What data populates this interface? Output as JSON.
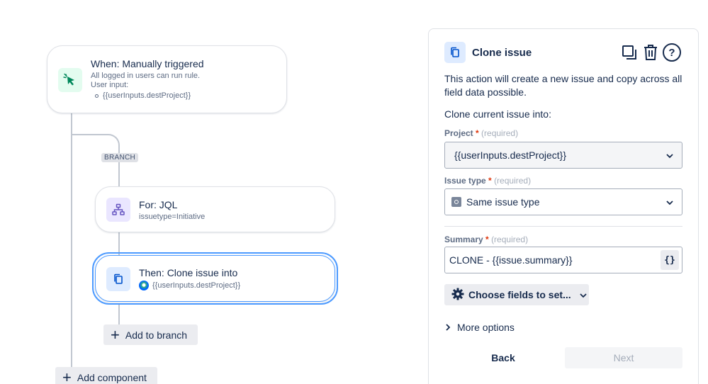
{
  "canvas": {
    "trigger": {
      "title": "When: Manually triggered",
      "line1": "All logged in users can run rule.",
      "line2": "User input:",
      "bullet": "{{userInputs.destProject}}"
    },
    "branch_badge": "BRANCH",
    "for_card": {
      "title": "For: JQL",
      "sub": "issuetype=Initiative"
    },
    "then_card": {
      "title": "Then: Clone issue into",
      "sub": "{{userInputs.destProject}}"
    },
    "add_to_branch": "Add to branch",
    "add_component": "Add component"
  },
  "panel": {
    "title": "Clone issue",
    "description": "This action will create a new issue and copy across all field data possible.",
    "clone_into": "Clone current issue into:",
    "project": {
      "label": "Project",
      "req": "*",
      "hint": "(required)",
      "value": "{{userInputs.destProject}}"
    },
    "issue_type": {
      "label": "Issue type",
      "req": "*",
      "hint": "(required)",
      "value": "Same issue type"
    },
    "summary": {
      "label": "Summary",
      "req": "*",
      "hint": "(required)",
      "value": "CLONE - {{issue.summary}}",
      "smart_btn": "{}"
    },
    "choose_fields": "Choose fields to set...",
    "more_options": "More options",
    "back": "Back",
    "next": "Next"
  },
  "colors": {
    "trigger_icon_bg": "#e3fcef",
    "trigger_icon": "#00875a",
    "for_icon_bg": "#eae6ff",
    "for_icon": "#6554c0",
    "action_icon_bg": "#deebff",
    "action_icon": "#0052cc",
    "selected_border": "#4c9aff",
    "required": "#de350b"
  }
}
